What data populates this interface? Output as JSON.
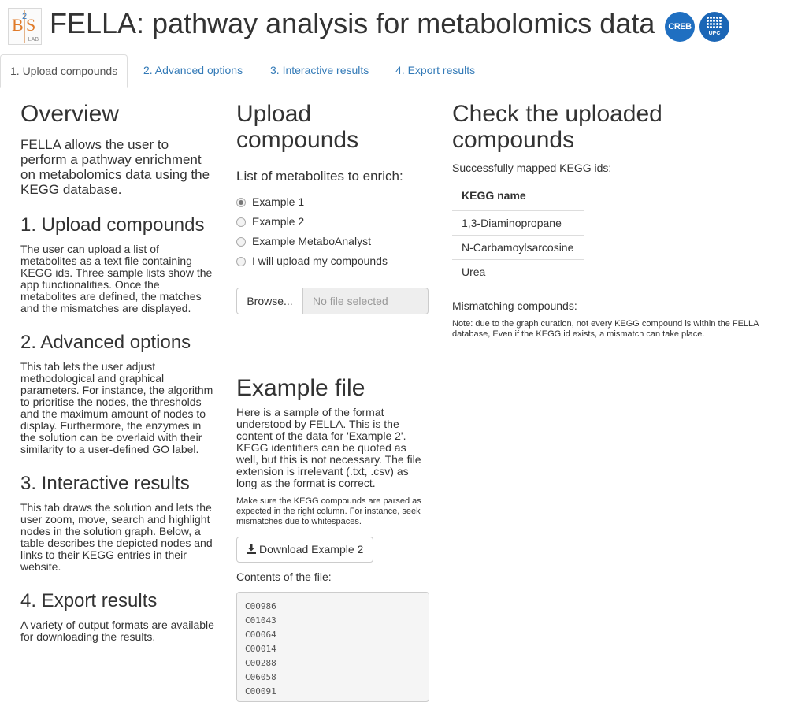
{
  "header": {
    "title": "FELLA: pathway analysis for metabolomics data",
    "logos": {
      "bis": {
        "main_left": "B",
        "superscript": "2",
        "main_right": "S",
        "sub": "LAB"
      },
      "creb": "CREB",
      "upc": "UPC"
    }
  },
  "tabs": [
    {
      "label": "1. Upload compounds",
      "active": true
    },
    {
      "label": "2. Advanced options",
      "active": false
    },
    {
      "label": "3. Interactive results",
      "active": false
    },
    {
      "label": "4. Export results",
      "active": false
    }
  ],
  "overview": {
    "title": "Overview",
    "lead": "FELLA allows the user to perform a pathway enrichment on metabolomics data using the KEGG database.",
    "sections": [
      {
        "title": "1. Upload compounds",
        "text": "The user can upload a list of metabolites as a text file containing KEGG ids. Three sample lists show the app functionalities. Once the metabolites are defined, the matches and the mismatches are displayed."
      },
      {
        "title": "2. Advanced options",
        "text": "This tab lets the user adjust methodological and graphical parameters. For instance, the algorithm to prioritise the nodes, the thresholds and the maximum amount of nodes to display. Furthermore, the enzymes in the solution can be overlaid with their similarity to a user-defined GO label."
      },
      {
        "title": "3. Interactive results",
        "text": "This tab draws the solution and lets the user zoom, move, search and highlight nodes in the solution graph. Below, a table describes the depicted nodes and links to their KEGG entries in their website."
      },
      {
        "title": "4. Export results",
        "text": "A variety of output formats are available for downloading the results."
      }
    ]
  },
  "upload": {
    "title": "Upload compounds",
    "list_label": "List of metabolites to enrich:",
    "options": [
      {
        "label": "Example 1",
        "checked": true
      },
      {
        "label": "Example 2",
        "checked": false
      },
      {
        "label": "Example MetaboAnalyst",
        "checked": false
      },
      {
        "label": "I will upload my compounds",
        "checked": false
      }
    ],
    "browse_label": "Browse...",
    "file_placeholder": "No file selected"
  },
  "example": {
    "title": "Example file",
    "text": "Here is a sample of the format understood by FELLA. This is the content of the data for 'Example 2'. KEGG identifiers can be quoted as well, but this is not necessary. The file extension is irrelevant (.txt, .csv) as long as the format is correct.",
    "note": "Make sure the KEGG compounds are parsed as expected in the right column. For instance, seek mismatches due to whitespaces.",
    "download_label": "Download Example 2",
    "contents_label": "Contents of the file:",
    "contents": "C00986\nC01043\nC00064\nC00014\nC00288\nC06058\nC00091"
  },
  "check": {
    "title": "Check the uploaded compounds",
    "mapped_label": "Successfully mapped KEGG ids:",
    "table_header": "KEGG name",
    "rows": [
      "1,3-Diaminopropane",
      "N-Carbamoylsarcosine",
      "Urea"
    ],
    "mismatch_label": "Mismatching compounds:",
    "note": "Note: due to the graph curation, not every KEGG compound is within the FELLA database, Even if the KEGG id exists, a mismatch can take place."
  }
}
